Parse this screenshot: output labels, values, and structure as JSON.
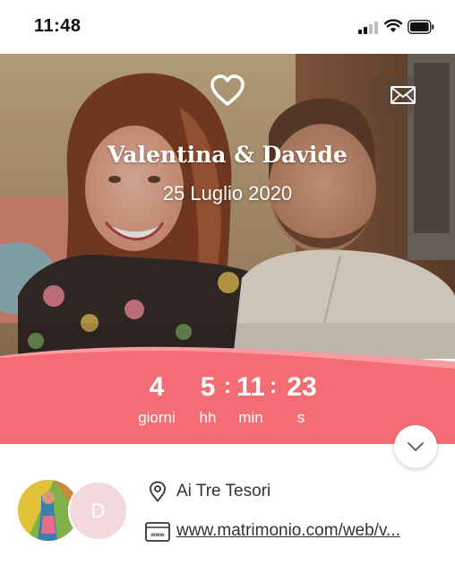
{
  "status_bar": {
    "time": "11:48",
    "icons": [
      "cellular-signal-icon",
      "wifi-icon",
      "battery-icon"
    ]
  },
  "hero": {
    "logo_icon": "heart-icon",
    "message_icon": "envelope-icon",
    "couple_names": "Valentina & Davide",
    "date": "25 Luglio 2020"
  },
  "countdown": {
    "days": {
      "value": "4",
      "label": "giorni"
    },
    "hours": {
      "value": "5",
      "label": "hh"
    },
    "minutes": {
      "value": "11",
      "label": "min"
    },
    "seconds": {
      "value": "23",
      "label": "s"
    },
    "separator": ":"
  },
  "scroll_button": {
    "icon": "chevron-down-icon"
  },
  "info": {
    "avatar_initial": "D",
    "venue_icon": "location-pin-icon",
    "venue": "Ai Tre Tesori",
    "website_icon": "web-page-icon",
    "website": "www.matrimonio.com/web/v..."
  },
  "colors": {
    "countdown_band": "#f46d74",
    "countdown_band_light": "#f99ba0",
    "avatar_placeholder": "#f3d9dd",
    "text": "#333333"
  }
}
